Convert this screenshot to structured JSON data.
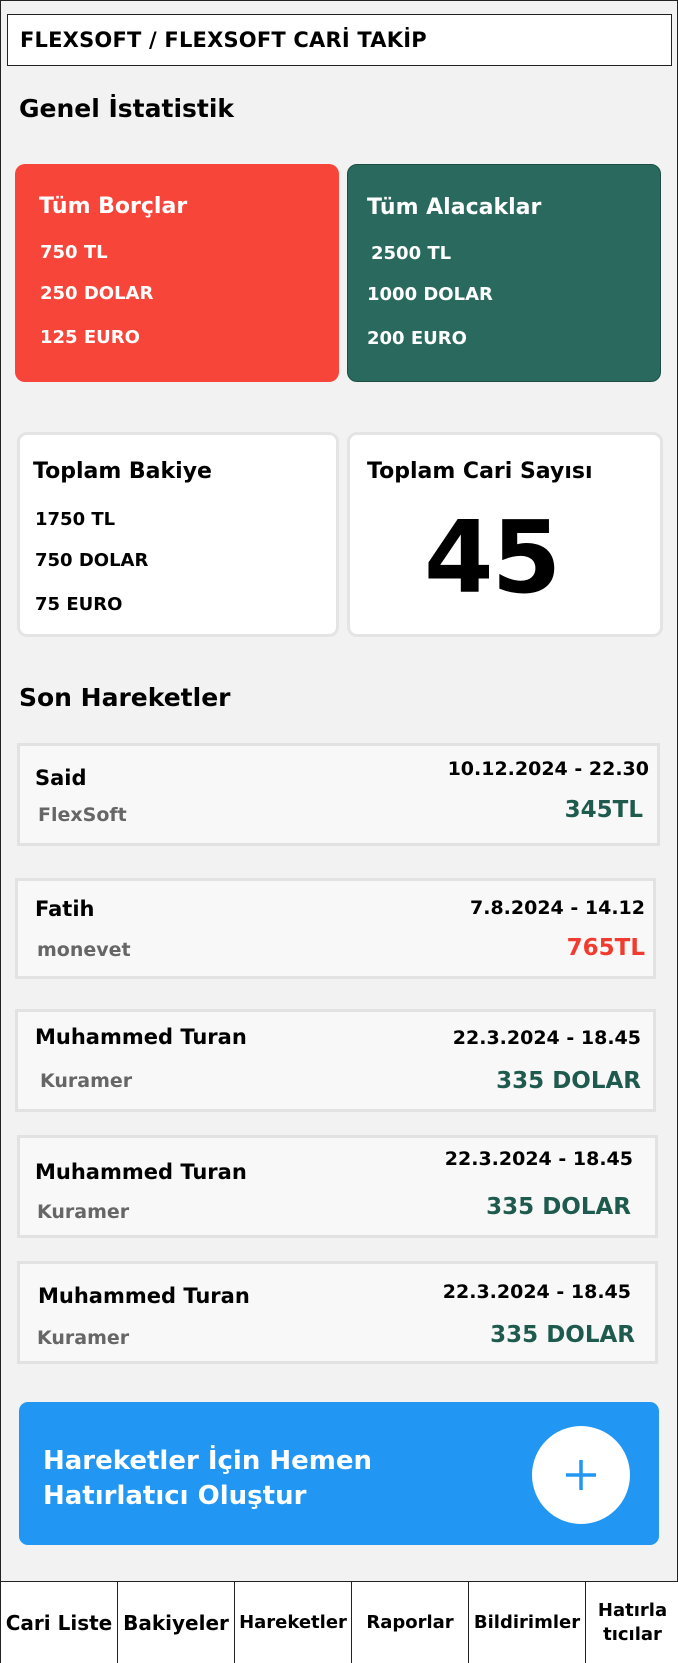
{
  "header": {
    "title": "FLEXSOFT / FLEXSOFT CARİ TAKİP"
  },
  "stats": {
    "section_title": "Genel İstatistik",
    "debts": {
      "title": "Tüm Borçlar",
      "lines": [
        "750 TL",
        "250 DOLAR",
        "125 EURO"
      ],
      "color": "#f7453a"
    },
    "receivables": {
      "title": "Tüm Alacaklar",
      "lines": [
        "2500 TL",
        "1000 DOLAR",
        "200 EURO"
      ],
      "color": "#2a6a5e"
    },
    "balance": {
      "title": "Toplam Bakiye",
      "lines": [
        "1750 TL",
        "750 DOLAR",
        "75 EURO"
      ]
    },
    "account_count": {
      "title": "Toplam Cari Sayısı",
      "value": "45"
    }
  },
  "movements": {
    "section_title": "Son Hareketler",
    "items": [
      {
        "name": "Said",
        "company": "FlexSoft",
        "date": "10.12.2024 - 22.30",
        "amount": "345TL",
        "type": "positive"
      },
      {
        "name": "Fatih",
        "company": "monevet",
        "date": "7.8.2024 - 14.12",
        "amount": "765TL",
        "type": "negative"
      },
      {
        "name": "Muhammed Turan",
        "company": "Kuramer",
        "date": "22.3.2024 - 18.45",
        "amount": "335 DOLAR",
        "type": "positive"
      },
      {
        "name": "Muhammed Turan",
        "company": "Kuramer",
        "date": "22.3.2024 - 18.45",
        "amount": "335 DOLAR",
        "type": "positive"
      },
      {
        "name": "Muhammed Turan",
        "company": "Kuramer",
        "date": "22.3.2024 - 18.45",
        "amount": "335 DOLAR",
        "type": "positive"
      }
    ]
  },
  "reminder": {
    "text_line1": "Hareketler İçin Hemen",
    "text_line2": "Hatırlatıcı Oluştur",
    "icon": "plus-icon",
    "color": "#2196f3"
  },
  "nav": {
    "items": [
      "Cari Liste",
      "Bakiyeler",
      "Hareketler",
      "Raporlar",
      "Bildirimler",
      "Hatırla tıcılar"
    ]
  }
}
